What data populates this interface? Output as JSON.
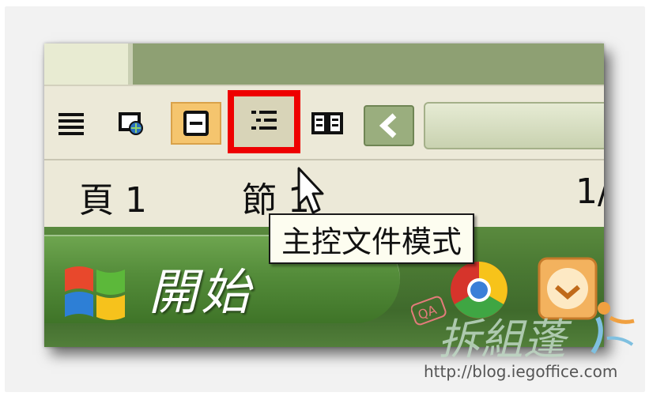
{
  "toolbar": {
    "buttons": [
      {
        "name": "normal-view",
        "icon": "lines-icon"
      },
      {
        "name": "web-layout-view",
        "icon": "web-page-icon"
      },
      {
        "name": "print-layout-view",
        "icon": "page-icon",
        "state": "active"
      },
      {
        "name": "master-document-view",
        "icon": "outline-icon",
        "state": "highlighted"
      },
      {
        "name": "reading-layout-view",
        "icon": "book-icon"
      }
    ],
    "highlight_color": "#ee0000"
  },
  "status_bar": {
    "page_label": "頁 1",
    "section_label": "節 1",
    "page_count": "1/"
  },
  "tooltip": {
    "text": "主控文件模式"
  },
  "taskbar": {
    "start_label": "開始"
  },
  "watermark": {
    "brand": "QA",
    "title": "拆組蓬",
    "url": "http://blog.iegoffice.com"
  },
  "colors": {
    "taskbar_green": "#4c7b34",
    "toolbar_bg": "#ece9d8",
    "active_button": "#f5c56e"
  }
}
